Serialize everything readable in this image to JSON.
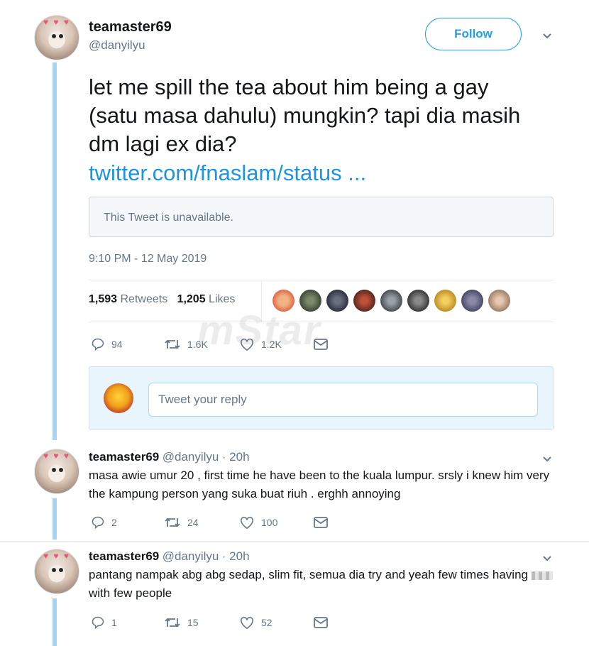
{
  "main_tweet": {
    "author_name": "teamaster69",
    "author_handle": "@danyilyu",
    "follow_label": "Follow",
    "text": "let me spill the tea about him being a gay (satu masa dahulu) mungkin? tapi dia masih dm lagi ex dia?",
    "link": "twitter.com/fnaslam/status ...",
    "quoted_unavailable": "This Tweet is unavailable.",
    "timestamp": "9:10 PM - 12 May 2019",
    "retweets_count": "1,593",
    "retweets_label": "Retweets",
    "likes_count": "1,205",
    "likes_label": "Likes",
    "actions": {
      "replies": "94",
      "retweets": "1.6K",
      "likes": "1.2K"
    }
  },
  "reply_composer": {
    "placeholder": "Tweet your reply"
  },
  "replies": [
    {
      "author_name": "teamaster69",
      "author_handle": "@danyilyu",
      "time": "· 20h",
      "text": "masa awie umur 20 , first time he have been to the kuala lumpur. srsly i knew him very the kampung person yang suka buat riuh . erghh annoying",
      "replies": "2",
      "retweets": "24",
      "likes": "100"
    },
    {
      "author_name": "teamaster69",
      "author_handle": "@danyilyu",
      "time": "· 20h",
      "text_before": "pantang nampak abg abg sedap, slim fit, semua dia try and yeah few times having",
      "text_after": "with few people",
      "replies": "1",
      "retweets": "15",
      "likes": "52"
    }
  ],
  "watermark": "mStar",
  "colors": {
    "accent": "#1da1f2",
    "link": "#1b95e0",
    "thread_line": "#a8d4f2",
    "muted": "#657786"
  }
}
